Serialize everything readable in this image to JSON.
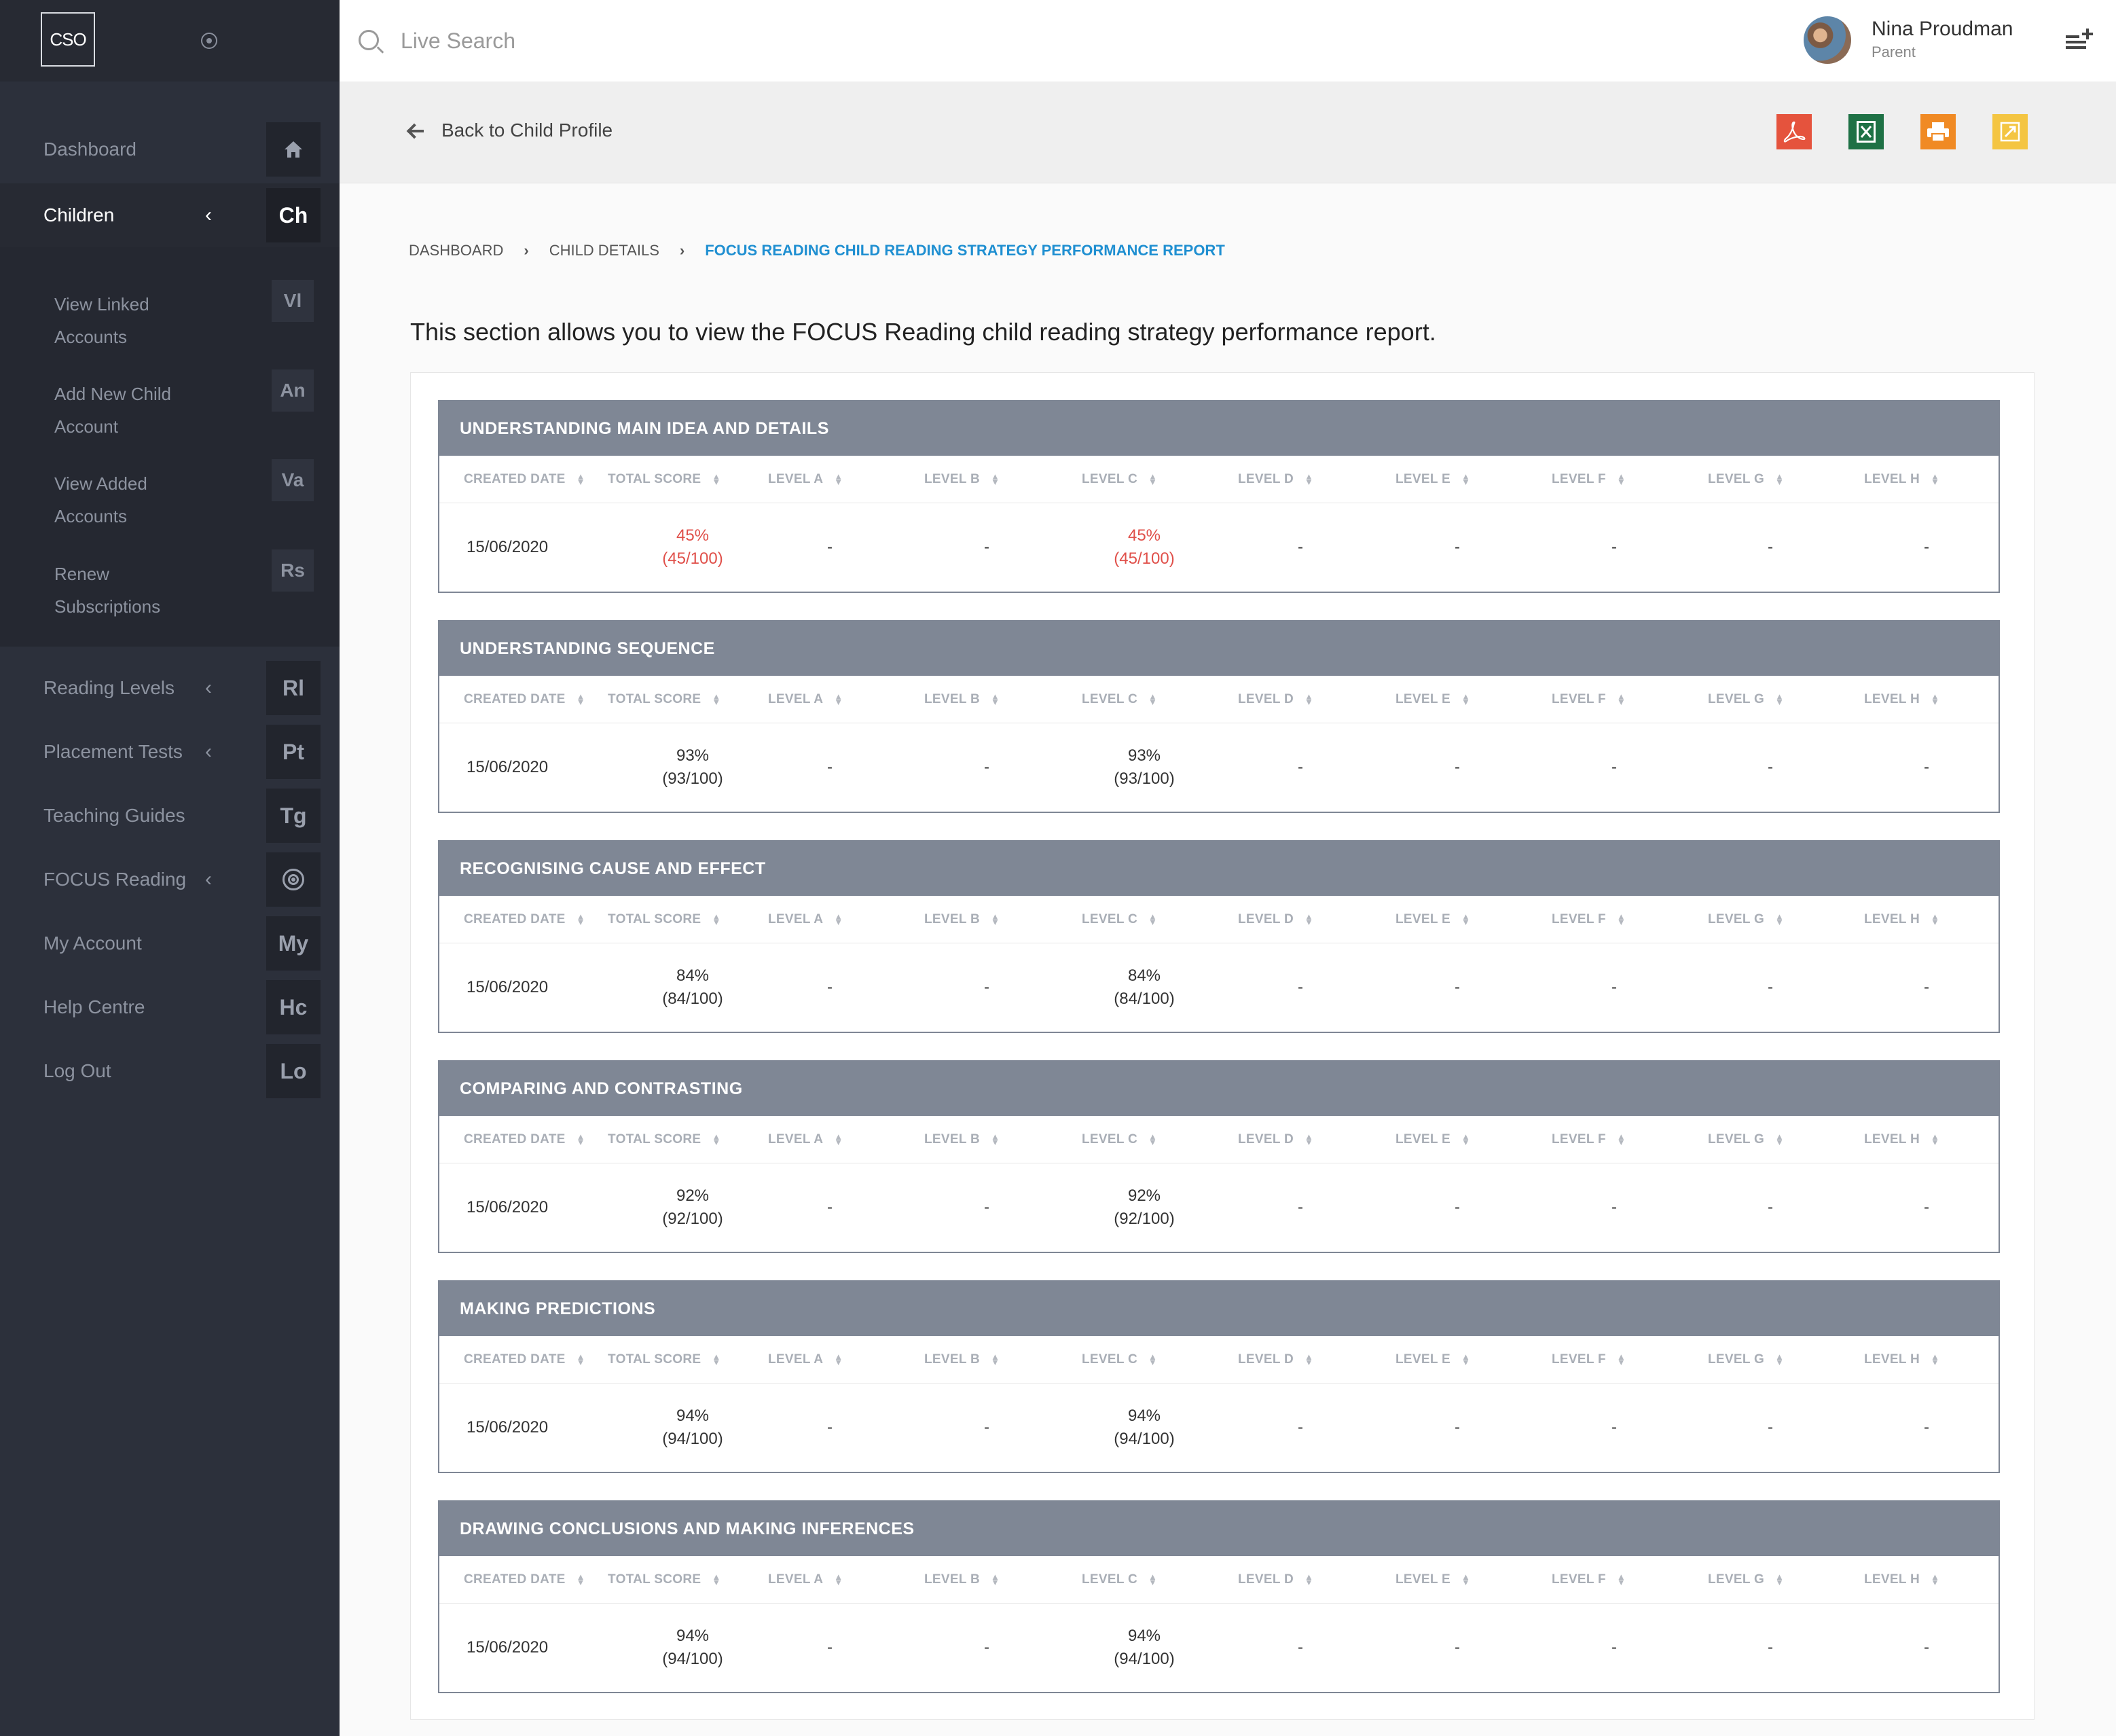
{
  "brand": {
    "logo_text": "CSO"
  },
  "sidebar": {
    "main_items": [
      {
        "label": "Dashboard",
        "badge": "",
        "chevron": "",
        "icon": "home-icon"
      },
      {
        "label": "Children",
        "badge": "Ch",
        "chevron": "‹",
        "active": true
      }
    ],
    "sub_items": [
      {
        "label": "View Linked Accounts",
        "badge": "Vl"
      },
      {
        "label": "Add New Child Account",
        "badge": "An"
      },
      {
        "label": "View Added Accounts",
        "badge": "Va"
      },
      {
        "label": "Renew Subscriptions",
        "badge": "Rs"
      }
    ],
    "lower_items": [
      {
        "label": "Reading Levels",
        "badge": "Rl",
        "chevron": "‹"
      },
      {
        "label": "Placement Tests",
        "badge": "Pt",
        "chevron": "‹"
      },
      {
        "label": "Teaching Guides",
        "badge": "Tg",
        "chevron": ""
      },
      {
        "label": "FOCUS Reading",
        "badge": "",
        "chevron": "‹",
        "icon": "target-icon"
      },
      {
        "label": "My Account",
        "badge": "My",
        "chevron": ""
      },
      {
        "label": "Help Centre",
        "badge": "Hc",
        "chevron": ""
      },
      {
        "label": "Log Out",
        "badge": "Lo",
        "chevron": ""
      }
    ]
  },
  "topbar": {
    "search_placeholder": "Live Search",
    "user_name": "Nina Proudman",
    "user_role": "Parent"
  },
  "subheader": {
    "back_label": "Back to Child Profile",
    "exports": [
      {
        "icon": "pdf-icon",
        "color": "#e5533d"
      },
      {
        "icon": "excel-icon",
        "color": "#1e7145"
      },
      {
        "icon": "print-icon",
        "color": "#f08a24"
      },
      {
        "icon": "expand-icon",
        "color": "#f4c542"
      }
    ]
  },
  "breadcrumb": {
    "items": [
      "DASHBOARD",
      "CHILD DETAILS"
    ],
    "current": "FOCUS READING CHILD READING STRATEGY PERFORMANCE REPORT"
  },
  "intro": "This section allows you to view the FOCUS Reading child reading strategy performance report.",
  "columns": [
    "CREATED DATE",
    "TOTAL SCORE",
    "LEVEL A",
    "LEVEL B",
    "LEVEL C",
    "LEVEL D",
    "LEVEL E",
    "LEVEL F",
    "LEVEL G",
    "LEVEL H"
  ],
  "reports": [
    {
      "title": "UNDERSTANDING MAIN IDEA AND DETAILS",
      "row": {
        "date": "15/06/2020",
        "total_pct": "45%",
        "total_frac": "(45/100)",
        "low": true,
        "levels": [
          "-",
          "-",
          {
            "pct": "45%",
            "frac": "(45/100)"
          },
          "-",
          "-",
          "-",
          "-",
          "-"
        ]
      }
    },
    {
      "title": "UNDERSTANDING SEQUENCE",
      "row": {
        "date": "15/06/2020",
        "total_pct": "93%",
        "total_frac": "(93/100)",
        "low": false,
        "levels": [
          "-",
          "-",
          {
            "pct": "93%",
            "frac": "(93/100)"
          },
          "-",
          "-",
          "-",
          "-",
          "-"
        ]
      }
    },
    {
      "title": "RECOGNISING CAUSE AND EFFECT",
      "row": {
        "date": "15/06/2020",
        "total_pct": "84%",
        "total_frac": "(84/100)",
        "low": false,
        "levels": [
          "-",
          "-",
          {
            "pct": "84%",
            "frac": "(84/100)"
          },
          "-",
          "-",
          "-",
          "-",
          "-"
        ]
      }
    },
    {
      "title": "COMPARING AND CONTRASTING",
      "row": {
        "date": "15/06/2020",
        "total_pct": "92%",
        "total_frac": "(92/100)",
        "low": false,
        "levels": [
          "-",
          "-",
          {
            "pct": "92%",
            "frac": "(92/100)"
          },
          "-",
          "-",
          "-",
          "-",
          "-"
        ]
      }
    },
    {
      "title": "MAKING PREDICTIONS",
      "row": {
        "date": "15/06/2020",
        "total_pct": "94%",
        "total_frac": "(94/100)",
        "low": false,
        "levels": [
          "-",
          "-",
          {
            "pct": "94%",
            "frac": "(94/100)"
          },
          "-",
          "-",
          "-",
          "-",
          "-"
        ]
      }
    },
    {
      "title": "DRAWING CONCLUSIONS AND MAKING INFERENCES",
      "row": {
        "date": "15/06/2020",
        "total_pct": "94%",
        "total_frac": "(94/100)",
        "low": false,
        "levels": [
          "-",
          "-",
          {
            "pct": "94%",
            "frac": "(94/100)"
          },
          "-",
          "-",
          "-",
          "-",
          "-"
        ]
      }
    }
  ]
}
